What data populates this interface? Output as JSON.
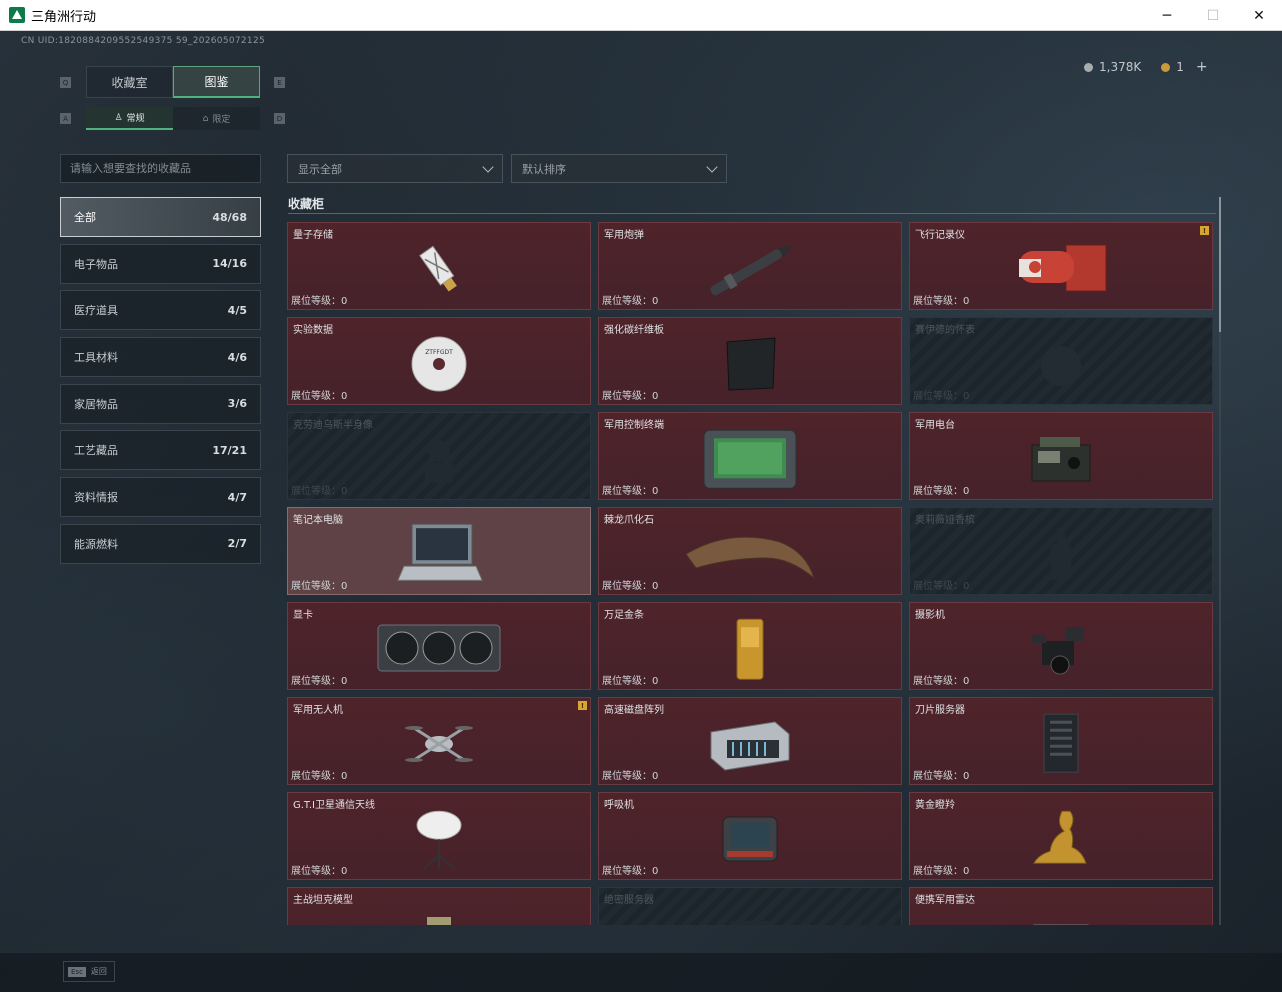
{
  "window": {
    "title": "三角洲行动",
    "minimize": "─",
    "maximize": "☐",
    "close": "✕"
  },
  "uid": "CN UID:1820884209552549375 59_202605072125",
  "currency": {
    "silver": "1,378K",
    "gold": "1",
    "plus": "+"
  },
  "key_hints": {
    "q": "Q",
    "e": "E",
    "a": "A",
    "d": "D"
  },
  "tabs": [
    {
      "label": "收藏室"
    },
    {
      "label": "图鉴"
    }
  ],
  "subtabs": [
    {
      "label": "常规"
    },
    {
      "label": "限定"
    }
  ],
  "search": {
    "placeholder": "请输入想要查找的收藏品"
  },
  "categories": [
    {
      "label": "全部",
      "count": "48/68"
    },
    {
      "label": "电子物品",
      "count": "14/16"
    },
    {
      "label": "医疗道具",
      "count": "4/5"
    },
    {
      "label": "工具材料",
      "count": "4/6"
    },
    {
      "label": "家居物品",
      "count": "3/6"
    },
    {
      "label": "工艺藏品",
      "count": "17/21"
    },
    {
      "label": "资料情报",
      "count": "4/7"
    },
    {
      "label": "能源燃料",
      "count": "2/7"
    }
  ],
  "filters": {
    "display": "显示全部",
    "sort": "默认排序"
  },
  "section_title": "收藏柜",
  "level_label": "展位等级：0",
  "badge_text": "!",
  "items": [
    {
      "name": "量子存储",
      "icon": "usb-drive-icon",
      "state": "owned"
    },
    {
      "name": "军用炮弹",
      "icon": "artillery-shell-icon",
      "state": "owned"
    },
    {
      "name": "飞行记录仪",
      "icon": "flight-recorder-icon",
      "state": "owned",
      "badge": true
    },
    {
      "name": "实验数据",
      "icon": "disc-icon",
      "state": "owned"
    },
    {
      "name": "强化碳纤维板",
      "icon": "carbon-plate-icon",
      "state": "owned"
    },
    {
      "name": "赛伊德的怀表",
      "icon": "pocket-watch-icon",
      "state": "locked"
    },
    {
      "name": "克劳迪乌斯半身像",
      "icon": "bust-icon",
      "state": "locked"
    },
    {
      "name": "军用控制终端",
      "icon": "control-terminal-icon",
      "state": "owned"
    },
    {
      "name": "军用电台",
      "icon": "radio-icon",
      "state": "owned"
    },
    {
      "name": "笔记本电脑",
      "icon": "laptop-icon",
      "state": "highlight"
    },
    {
      "name": "棘龙爪化石",
      "icon": "claw-fossil-icon",
      "state": "owned"
    },
    {
      "name": "奥莉薇娅香槟",
      "icon": "champagne-icon",
      "state": "locked"
    },
    {
      "name": "显卡",
      "icon": "gpu-icon",
      "state": "owned"
    },
    {
      "name": "万足金条",
      "icon": "gold-bar-icon",
      "state": "owned"
    },
    {
      "name": "摄影机",
      "icon": "camera-icon",
      "state": "owned"
    },
    {
      "name": "军用无人机",
      "icon": "drone-icon",
      "state": "owned",
      "badge": true
    },
    {
      "name": "高速磁盘阵列",
      "icon": "disk-array-icon",
      "state": "owned"
    },
    {
      "name": "刀片服务器",
      "icon": "blade-server-icon",
      "state": "owned"
    },
    {
      "name": "G.T.I卫星通信天线",
      "icon": "satellite-dish-icon",
      "state": "owned"
    },
    {
      "name": "呼吸机",
      "icon": "ventilator-icon",
      "state": "owned"
    },
    {
      "name": "黄金瞪羚",
      "icon": "gold-gazelle-icon",
      "state": "owned"
    },
    {
      "name": "主战坦克模型",
      "icon": "tank-model-icon",
      "state": "owned"
    },
    {
      "name": "绝密服务器",
      "icon": "server-icon",
      "state": "locked"
    },
    {
      "name": "便携军用雷达",
      "icon": "radar-icon",
      "state": "owned"
    }
  ],
  "bottom": {
    "esc_key": "Esc",
    "esc_label": "返回"
  },
  "colors": {
    "accent_green": "#4fb37f",
    "card_owned": "#4f232a",
    "card_locked": "#1c252c",
    "badge": "#d9a531"
  }
}
